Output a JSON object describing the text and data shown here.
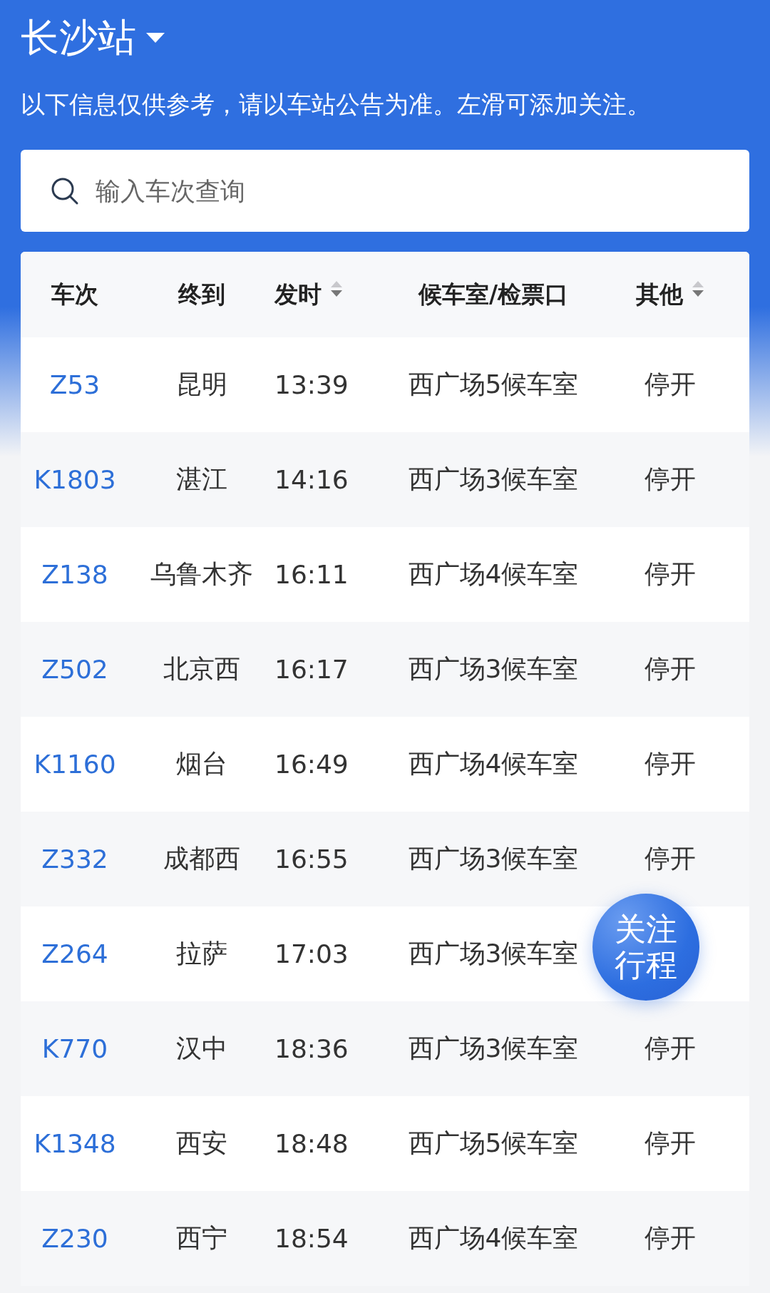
{
  "header": {
    "station": "长沙站",
    "notice": "以下信息仅供参考，请以车站公告为准。左滑可添加关注。"
  },
  "search": {
    "placeholder": "输入车次查询"
  },
  "table": {
    "columns": [
      {
        "label": "车次",
        "sortable": false
      },
      {
        "label": "终到",
        "sortable": false
      },
      {
        "label": "发时",
        "sortable": true
      },
      {
        "label": "候车室/检票口",
        "sortable": false
      },
      {
        "label": "其他",
        "sortable": true
      }
    ],
    "rows": [
      {
        "train": "Z53",
        "destination": "昆明",
        "departs": "13:39",
        "waiting_room": "西广场5候车室",
        "other": "停开"
      },
      {
        "train": "K1803",
        "destination": "湛江",
        "departs": "14:16",
        "waiting_room": "西广场3候车室",
        "other": "停开"
      },
      {
        "train": "Z138",
        "destination": "乌鲁木齐",
        "departs": "16:11",
        "waiting_room": "西广场4候车室",
        "other": "停开"
      },
      {
        "train": "Z502",
        "destination": "北京西",
        "departs": "16:17",
        "waiting_room": "西广场3候车室",
        "other": "停开"
      },
      {
        "train": "K1160",
        "destination": "烟台",
        "departs": "16:49",
        "waiting_room": "西广场4候车室",
        "other": "停开"
      },
      {
        "train": "Z332",
        "destination": "成都西",
        "departs": "16:55",
        "waiting_room": "西广场3候车室",
        "other": "停开"
      },
      {
        "train": "Z264",
        "destination": "拉萨",
        "departs": "17:03",
        "waiting_room": "西广场3候车室"
      },
      {
        "train": "K770",
        "destination": "汉中",
        "departs": "18:36",
        "waiting_room": "西广场3候车室",
        "other": "停开"
      },
      {
        "train": "K1348",
        "destination": "西安",
        "departs": "18:48",
        "waiting_room": "西广场5候车室",
        "other": "停开"
      },
      {
        "train": "Z230",
        "destination": "西宁",
        "departs": "18:54",
        "waiting_room": "西广场4候车室",
        "other": "停开"
      }
    ]
  },
  "follow_button": {
    "lines": [
      "关注",
      "行程"
    ]
  }
}
